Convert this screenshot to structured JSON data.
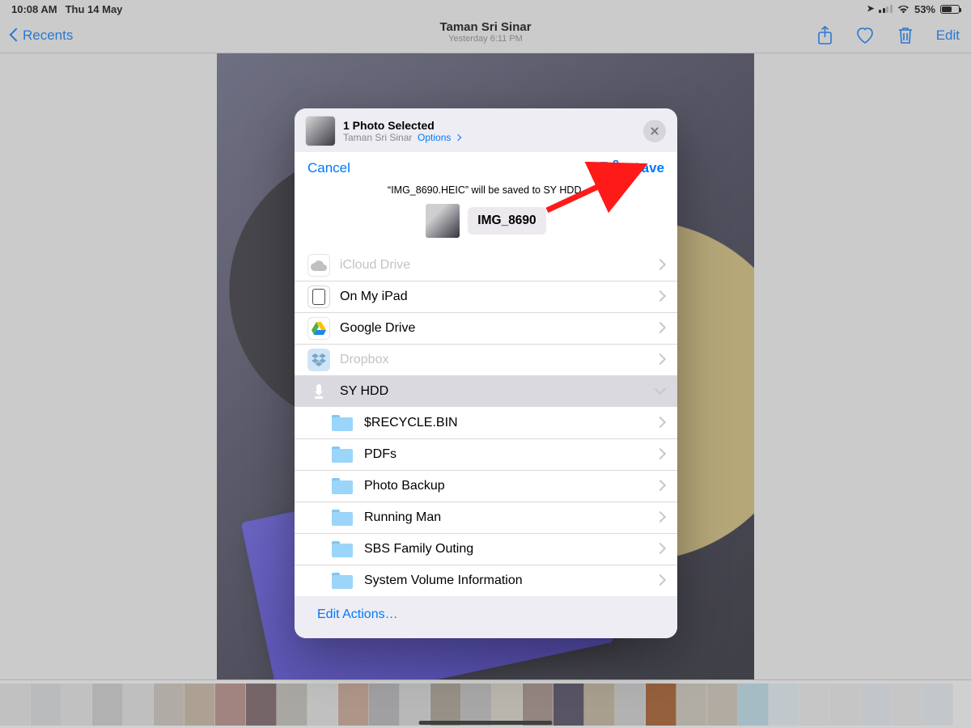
{
  "statusbar": {
    "time": "10:08 AM",
    "date": "Thu 14 May",
    "battery_pct": "53%"
  },
  "navbar": {
    "back_label": "Recents",
    "title": "Taman Sri Sinar",
    "subtitle": "Yesterday  6:11 PM",
    "edit_label": "Edit"
  },
  "sheet_header": {
    "selected_label": "1 Photo Selected",
    "location": "Taman Sri Sinar",
    "options_label": "Options"
  },
  "save": {
    "cancel_label": "Cancel",
    "save_label": "Save",
    "message": "“IMG_8690.HEIC” will be saved to SY HDD.",
    "file_name": "IMG_8690"
  },
  "locations": [
    {
      "id": "icloud",
      "label": "iCloud Drive",
      "disabled": true,
      "selected": false,
      "caret": "right"
    },
    {
      "id": "ipad",
      "label": "On My iPad",
      "disabled": false,
      "selected": false,
      "caret": "right"
    },
    {
      "id": "gdrive",
      "label": "Google Drive",
      "disabled": false,
      "selected": false,
      "caret": "right"
    },
    {
      "id": "dropbox",
      "label": "Dropbox",
      "disabled": true,
      "selected": false,
      "caret": "right"
    },
    {
      "id": "syhdd",
      "label": "SY HDD",
      "disabled": false,
      "selected": true,
      "caret": "down"
    }
  ],
  "folders": [
    {
      "label": "$RECYCLE.BIN"
    },
    {
      "label": "PDFs"
    },
    {
      "label": "Photo Backup"
    },
    {
      "label": "Running Man"
    },
    {
      "label": "SBS Family Outing"
    },
    {
      "label": "System Volume Information"
    }
  ],
  "edit_actions_label": "Edit Actions…",
  "filmstrip_colors": [
    "#e8e8ea",
    "#dedfe2",
    "#e8e8ea",
    "#cfcfd1",
    "#e5e5e6",
    "#cec8bd",
    "#c9b7a4",
    "#b78b85",
    "#735b62",
    "#c4c0b7",
    "#e7e6e8",
    "#cba591",
    "#b6b6b9",
    "#dadada",
    "#a69d90",
    "#c0c0c2",
    "#dcd6ca",
    "#a38c86",
    "#47415a",
    "#c4b49c",
    "#d1d1d3",
    "#a4541f",
    "#d2c9bc",
    "#cfc6b9",
    "#bde0ef",
    "#e8f3f8",
    "#f0f0f2",
    "#eeeef0",
    "#eaeff6",
    "#f0f0f2",
    "#ecf1f7"
  ]
}
